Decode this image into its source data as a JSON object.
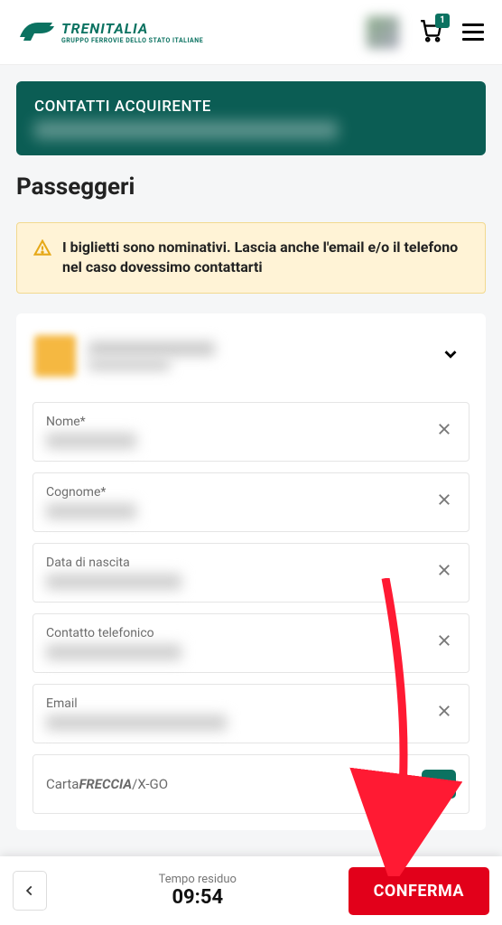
{
  "header": {
    "brand": "TRENITALIA",
    "subtitle": "GRUPPO FERROVIE DELLO STATO ITALIANE",
    "cart_count": "1"
  },
  "buyer": {
    "title": "CONTATTI ACQUIRENTE"
  },
  "section": {
    "title": "Passeggeri"
  },
  "notice": {
    "text": "I biglietti sono nominativi. Lascia anche l'email e/o il telefono nel caso dovessimo contattarti"
  },
  "fields": {
    "nome": "Nome*",
    "cognome": "Cognome*",
    "data_nascita": "Data di nascita",
    "telefono": "Contatto telefonico",
    "email": "Email",
    "carta_prefix": "Carta",
    "carta_bold": "FRECCIA",
    "carta_suffix": "/X-GO"
  },
  "bottom": {
    "timer_label": "Tempo residuo",
    "timer_value": "09:54",
    "confirm": "CONFERMA"
  }
}
